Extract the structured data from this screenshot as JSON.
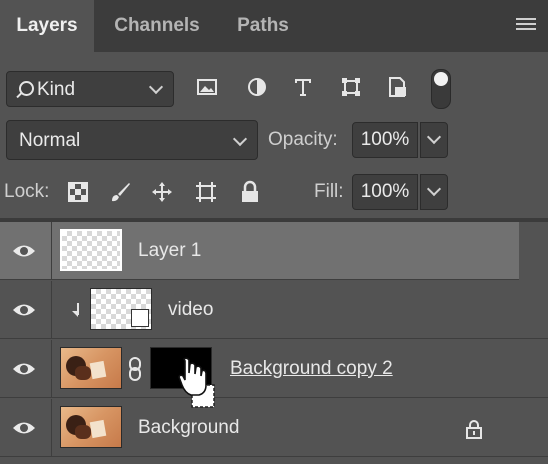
{
  "tabs": [
    {
      "label": "Layers",
      "active": true
    },
    {
      "label": "Channels",
      "active": false
    },
    {
      "label": "Paths",
      "active": false
    }
  ],
  "filter": {
    "kind_label": "Kind",
    "icons": [
      "image-filter-icon",
      "adjustment-filter-icon",
      "type-filter-icon",
      "shape-filter-icon",
      "smart-object-filter-icon"
    ]
  },
  "blend": {
    "mode": "Normal",
    "opacity_label": "Opacity:",
    "opacity_value": "100%"
  },
  "lock": {
    "label": "Lock:",
    "fill_label": "Fill:",
    "fill_value": "100%"
  },
  "layers": [
    {
      "name": "Layer 1",
      "selected": true
    },
    {
      "name": "video",
      "clipped": true,
      "smart_object": true
    },
    {
      "name": "Background copy 2",
      "has_mask": true,
      "linked": true
    },
    {
      "name": "Background",
      "locked": true
    }
  ],
  "colors": {
    "panel_bg": "#535353",
    "tabbar_bg": "#3c3c3c",
    "selected_row": "#717171",
    "field_bg": "#3f3f3f"
  }
}
